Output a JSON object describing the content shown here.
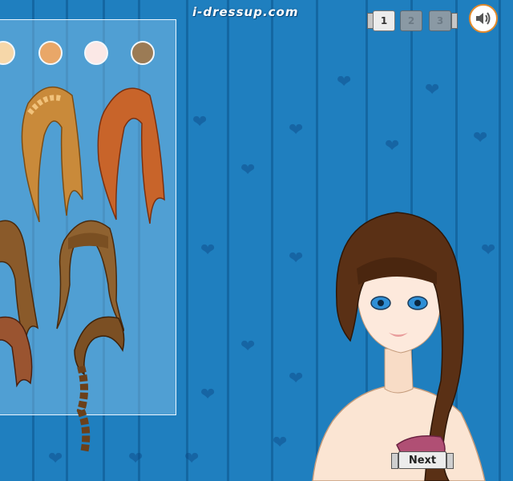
{
  "header": {
    "site_title": "i-dressup.com",
    "pages": [
      "1",
      "2",
      "3"
    ],
    "active_page": "1"
  },
  "sound": {
    "icon": "speaker-icon"
  },
  "panel": {
    "skin_swatches": [
      {
        "name": "swatch-light",
        "color": "#f6d7a9"
      },
      {
        "name": "swatch-tan",
        "color": "#e9a768"
      },
      {
        "name": "swatch-pink",
        "color": "#fbe8e6"
      },
      {
        "name": "swatch-olive",
        "color": "#9b7b55"
      }
    ],
    "hair_options": [
      "blonde-braided-long-hair",
      "auburn-long-hair",
      "wavy-brown-hair",
      "brown-bangs-wavy-hair",
      "short-auburn-curly-hair",
      "brown-side-braid-hair"
    ]
  },
  "next_button": {
    "label": "Next"
  },
  "colors": {
    "background": "#1f7fbf",
    "panel_border": "#eaf6ff",
    "sound_ring": "#e38a2b"
  }
}
